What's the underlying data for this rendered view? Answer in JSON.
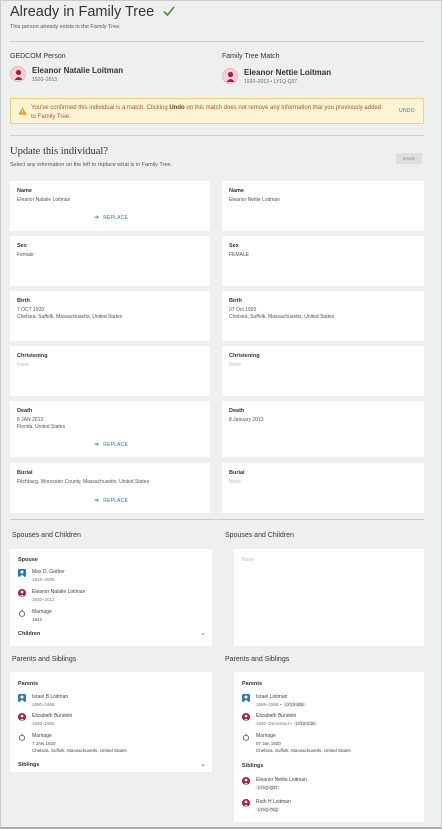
{
  "header": {
    "title": "Already in Family Tree",
    "subtitle": "This person already exists in the Family Tree.",
    "check_color": "#4a8f2e"
  },
  "gedcom": {
    "heading": "GEDCOM Person",
    "name": "Eleanor Natalie Loitman",
    "dates": "1920–2013"
  },
  "tree_match": {
    "heading": "Family Tree Match",
    "name": "Eleanor Nettie Loitman",
    "dates": "1920–2013",
    "pid": "LY1Q-Q37"
  },
  "warning": {
    "text_before": "You've confirmed this individual is a match. Clicking ",
    "bold": "Undo",
    "text_after": " on this match does not remove any information that you previously added to Family Tree.",
    "undo_label": "UNDO"
  },
  "update": {
    "title": "Update this individual?",
    "subtitle": "Select any information on the left to replace what is in Family Tree.",
    "save_label": "SAVE"
  },
  "replace_label": "REPLACE",
  "fields": {
    "name": {
      "label": "Name",
      "left": [
        "Eleanor Natalie Loitman"
      ],
      "right": [
        "Eleanor Nettie Loitman"
      ]
    },
    "sex": {
      "label": "Sex",
      "left": [
        "Female"
      ],
      "right": [
        "FEMALE"
      ]
    },
    "birth": {
      "label": "Birth",
      "left": [
        "7 OCT 1920",
        "Chelsea, Suffolk, Massachusetts, United States"
      ],
      "right": [
        "07 Oct 1920",
        "Chelsea, Suffolk, Massachusetts, United States"
      ]
    },
    "christening": {
      "label": "Christening",
      "left": [
        "None"
      ],
      "right": [
        "None"
      ]
    },
    "death": {
      "label": "Death",
      "left": [
        "8 JAN 2013",
        "Florida, United States"
      ],
      "right": [
        "8 January 2013"
      ]
    },
    "burial": {
      "label": "Burial",
      "left": [
        "Fitchburg, Worcester County, Massachusetts, United States"
      ],
      "right": [
        "None"
      ]
    }
  },
  "spouses": {
    "heading": "Spouses and Children",
    "spouse_label": "Spouse",
    "spouse1_name": "Max D. Garber",
    "spouse1_dates": "1916–2006",
    "spouse2_name": "Eleanor Natalie Loitman",
    "spouse2_dates": "1920–2013",
    "marriage_label": "Marriage",
    "marriage_date": "1942",
    "children_label": "Children",
    "right_none": "None"
  },
  "parents": {
    "heading": "Parents and Siblings",
    "parents_label": "Parents",
    "left": {
      "father_name": "Israel B Loitman",
      "father_dates": "1890–1968",
      "mother_name": "Elizabeth Burstein",
      "mother_dates": "1900–1982",
      "marriage_label": "Marriage",
      "marriage_date": "7 JAN 1920",
      "marriage_place": "Chelsea, Suffolk, Massachusetts, United States",
      "siblings_label": "Siblings"
    },
    "right": {
      "father_name": "Israel Loitman",
      "father_dates": "1889–1968 •",
      "father_pid": "LY1S-836",
      "mother_name": "Elizabeth Burstein",
      "mother_dates": "1900–Deceased •",
      "mother_pid": "LY1S-C1K",
      "marriage_label": "Marriage",
      "marriage_date": "07 Jan 1920",
      "marriage_place": "Chelsea, Suffolk, Massachusetts, United States",
      "siblings_label": "Siblings",
      "sib1_name": "Eleanor Nettie Loitman",
      "sib1_pid": "LY1Q-Q37",
      "sib2_name": "Ruth H Loitman",
      "sib2_pid": "LY1Q-75Q"
    }
  }
}
